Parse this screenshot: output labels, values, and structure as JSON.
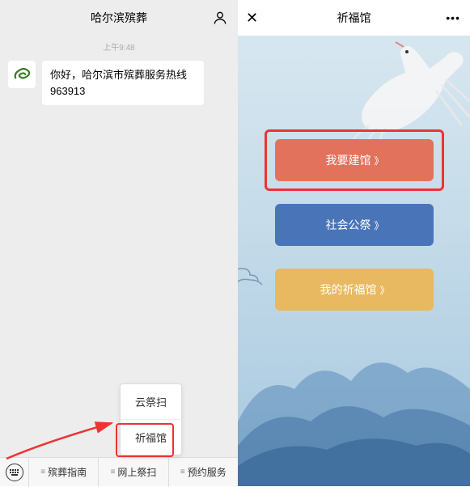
{
  "left": {
    "title": "哈尔滨殡葬",
    "timestamp": "上午9:48",
    "message": "你好，哈尔滨市殡葬服务热线963913",
    "popup": {
      "item1": "云祭扫",
      "item2": "祈福馆"
    },
    "menu": {
      "item1": "殡葬指南",
      "item2": "网上祭扫",
      "item3": "预约服务"
    }
  },
  "right": {
    "title": "祈福馆",
    "close": "✕",
    "more": "•••",
    "buttons": {
      "red": "我要建馆",
      "blue": "社会公祭",
      "yellow": "我的祈福馆"
    },
    "chevrons": "》"
  }
}
